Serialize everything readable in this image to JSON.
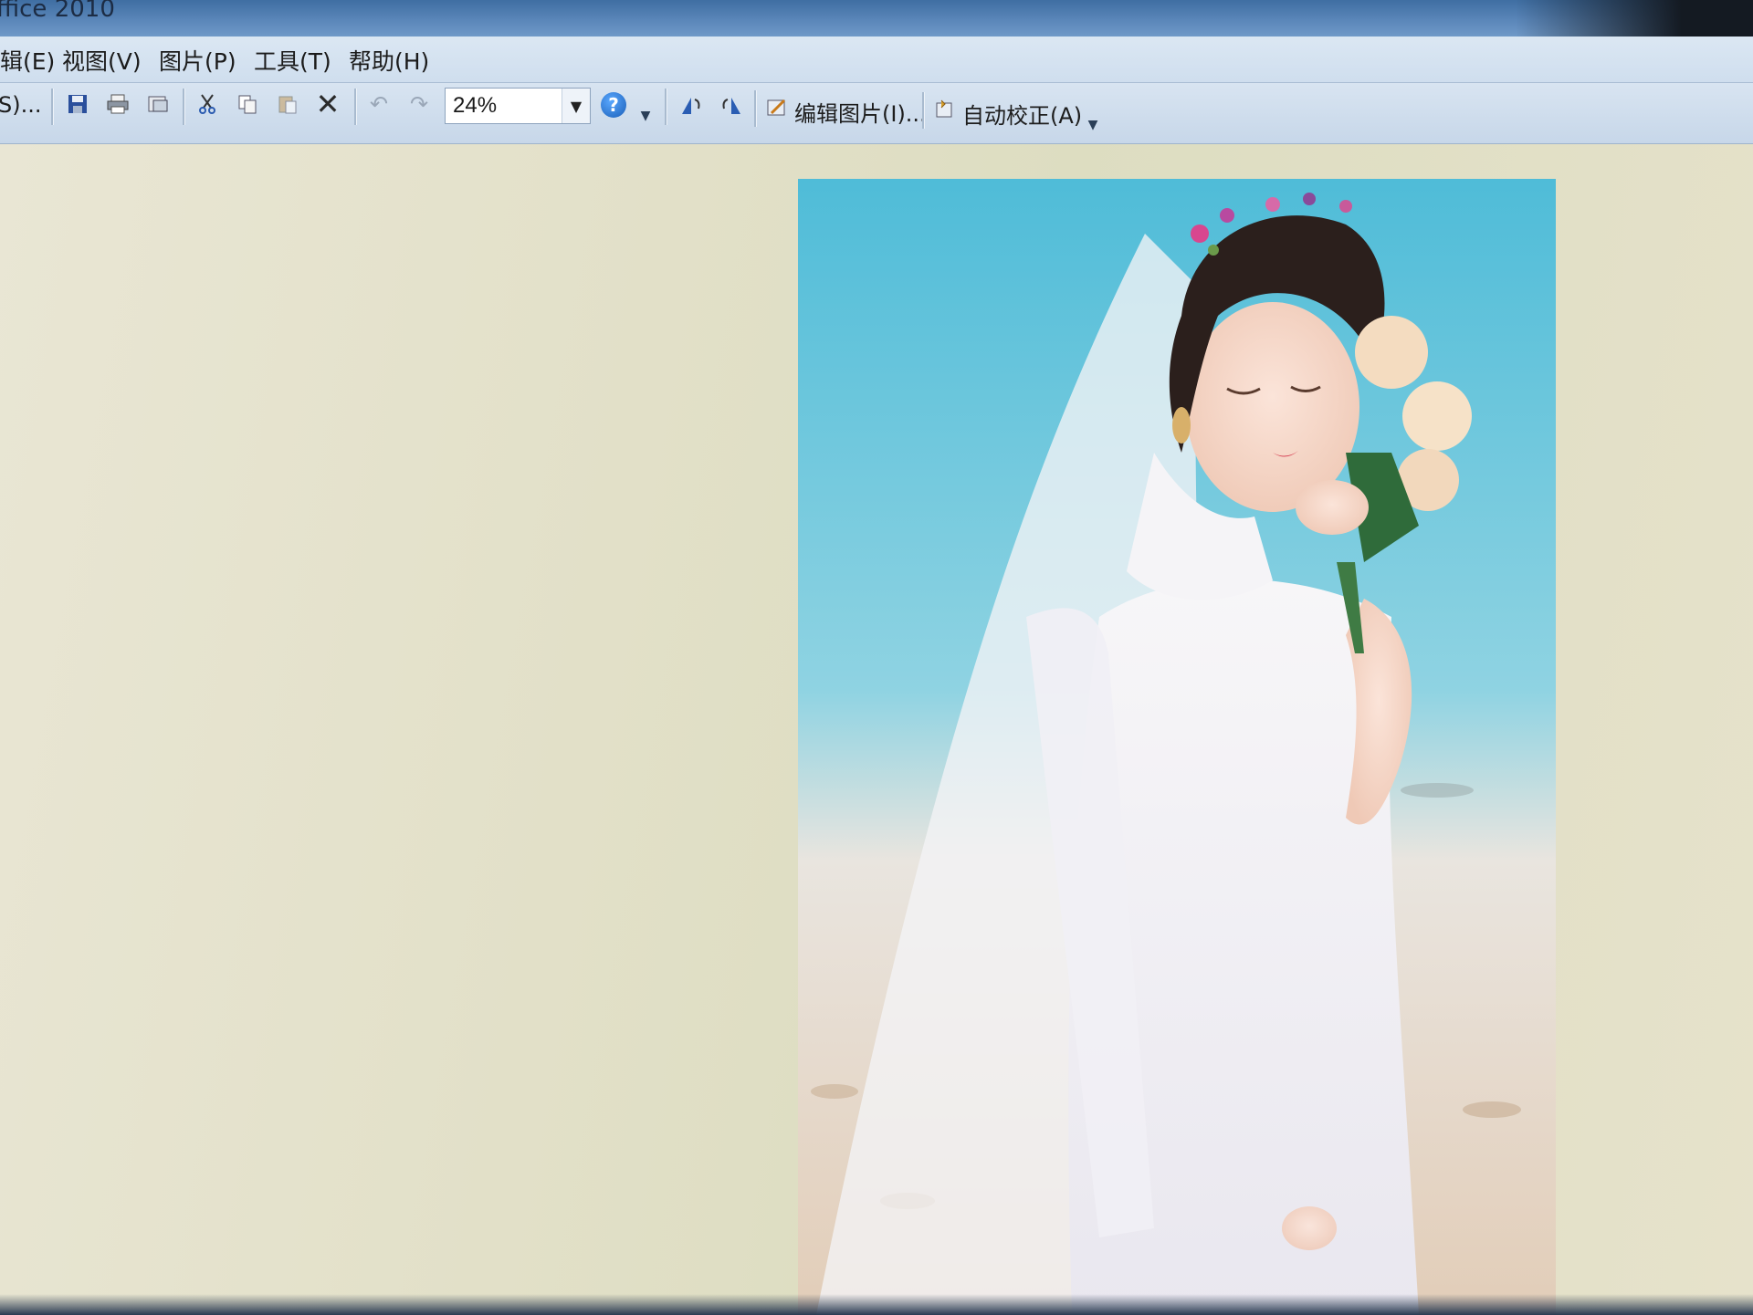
{
  "window": {
    "title": "ffice 2010"
  },
  "menu": [
    {
      "label": "辑(E)"
    },
    {
      "label": "视图(V)"
    },
    {
      "label": "图片(P)"
    },
    {
      "label": "工具(T)"
    },
    {
      "label": "帮助(H)"
    }
  ],
  "toolbar": {
    "open_label": "S)...",
    "zoom_value": "24%",
    "edit_picture_label": "编辑图片(I)...",
    "auto_correct_label": "自动校正(A)"
  },
  "icons": {
    "save": "save-icon",
    "print": "print-icon",
    "email": "email-icon",
    "cut": "cut-icon",
    "copy": "copy-icon",
    "paste": "paste-icon",
    "delete": "delete-icon",
    "undo": "undo-icon",
    "redo": "redo-icon",
    "help": "help-icon",
    "rotate_left": "rotate-left-icon",
    "rotate_right": "rotate-right-icon"
  },
  "colors": {
    "title_bar": "#4a77ab",
    "toolbar": "#cfdeee",
    "canvas": "#e3e1c9"
  }
}
